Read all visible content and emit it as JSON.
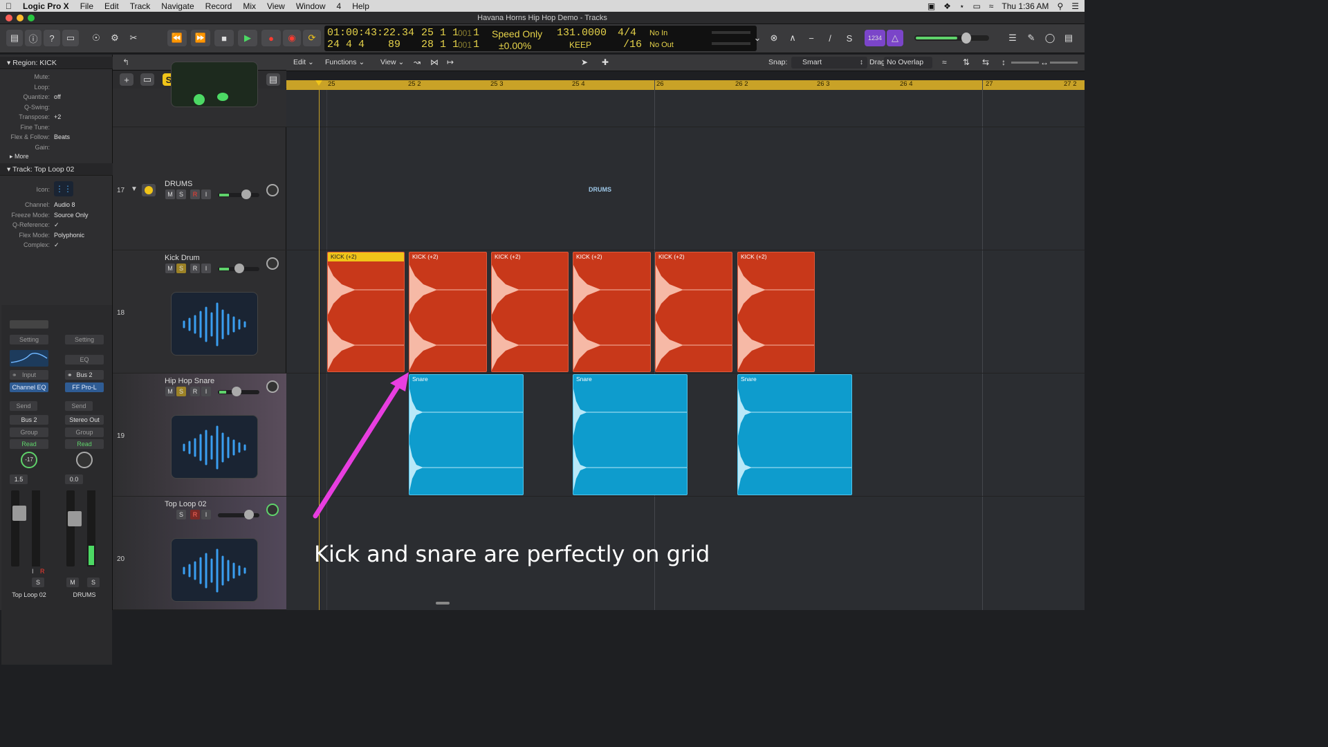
{
  "menubar": {
    "app_name": "Logic Pro X",
    "items": [
      "File",
      "Edit",
      "Track",
      "Navigate",
      "Record",
      "Mix",
      "View",
      "Window",
      "4",
      "Help"
    ],
    "clock": "Thu 1:36 AM"
  },
  "window": {
    "title": "Havana Horns Hip Hop Demo - Tracks"
  },
  "lcd": {
    "smpte": "01:00:43:22.34",
    "bars_a": "25   1   1",
    "bars_a_tick": "001",
    "bars_a_last": "1",
    "bars_b": "24   4   4",
    "bars_b_tick": "89",
    "bars_c": "28   1   1",
    "bars_c_tick": "001",
    "bars_c_last": "1",
    "mode": "Speed Only",
    "mode_pct": "±0.00%",
    "tempo": "131.0000",
    "tempo_mode": "KEEP",
    "signature": "4/4",
    "division": "/16",
    "midi_in": "No In",
    "midi_out": "No Out"
  },
  "toolbar": {
    "lcd_mode_badge": "1234"
  },
  "inspector": {
    "region_header": "Region: KICK",
    "region_rows": [
      {
        "label": "Mute:",
        "value": ""
      },
      {
        "label": "Loop:",
        "value": ""
      },
      {
        "label": "Quantize:",
        "value": "off"
      },
      {
        "label": "Q-Swing:",
        "value": ""
      },
      {
        "label": "Transpose:",
        "value": "+2"
      },
      {
        "label": "Fine Tune:",
        "value": ""
      },
      {
        "label": "Flex & Follow:",
        "value": "Beats"
      },
      {
        "label": "Gain:",
        "value": ""
      }
    ],
    "more": "More",
    "track_header": "Track:  Top Loop 02",
    "track_rows": [
      {
        "label": "Icon:",
        "value": ""
      },
      {
        "label": "Channel:",
        "value": "Audio 8"
      },
      {
        "label": "Freeze Mode:",
        "value": "Source Only"
      },
      {
        "label": "Q-Reference:",
        "value": "✓"
      },
      {
        "label": "Flex Mode:",
        "value": "Polyphonic"
      },
      {
        "label": "Complex:",
        "value": "✓"
      }
    ]
  },
  "strips": {
    "left": {
      "setting": "Setting",
      "input": "Input",
      "plugin": "Channel EQ",
      "send": "Send",
      "output": "Bus 2",
      "group": "Group",
      "automation": "Read",
      "pan": "-17",
      "gain": "1.5",
      "name": "Top Loop 02",
      "solo": "S",
      "i": "I",
      "r": "R"
    },
    "right": {
      "setting": "Setting",
      "eq": "EQ",
      "bus": "Bus 2",
      "plugin": "FF Pro-L",
      "send": "Send",
      "output": "Stereo Out",
      "group": "Group",
      "automation": "Read",
      "gain": "0.0",
      "name": "DRUMS",
      "mute": "M",
      "solo": "S"
    }
  },
  "tracks": [
    {
      "num": "17",
      "name": "DRUMS"
    },
    {
      "num": "18",
      "name": "Kick Drum"
    },
    {
      "num": "19",
      "name": "Hip Hop Snare"
    },
    {
      "num": "20",
      "name": "Top Loop 02"
    }
  ],
  "track_buttons": {
    "m": "M",
    "s": "S",
    "r": "R",
    "i": "I"
  },
  "area_header": {
    "edit": "Edit",
    "functions": "Functions",
    "view": "View",
    "snap_label": "Snap:",
    "snap_value": "Smart",
    "drag_label": "Drag:",
    "drag_value": "No Overlap"
  },
  "ruler": [
    "25",
    "25 2",
    "25 3",
    "25 4",
    "26",
    "26 2",
    "26 3",
    "26 4",
    "27",
    "27 2"
  ],
  "folder_label": "DRUMS",
  "kick_label": "KICK (+2)",
  "snare_label": "Snare",
  "annotation": "Kick and snare are perfectly on grid",
  "colors": {
    "kick": "#c8381a",
    "snare": "#0e9ccd",
    "ruler": "#c9a227",
    "arrow": "#e83ee0"
  }
}
